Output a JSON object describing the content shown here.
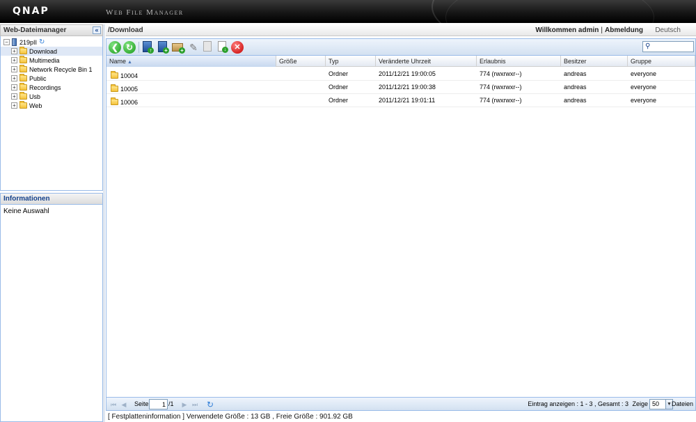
{
  "header": {
    "logo": "QNAP",
    "app_title": "Web File Manager"
  },
  "left_panel": {
    "title": "Web-Dateimanager",
    "collapse_glyph": "«",
    "tree": {
      "root": "219pII",
      "items": [
        {
          "label": "Download",
          "selected": true
        },
        {
          "label": "Multimedia"
        },
        {
          "label": "Network Recycle Bin 1"
        },
        {
          "label": "Public"
        },
        {
          "label": "Recordings"
        },
        {
          "label": "Usb"
        },
        {
          "label": "Web"
        }
      ]
    }
  },
  "info_panel": {
    "title": "Informationen",
    "body": "Keine Auswahl"
  },
  "path_bar": {
    "path": "/Download",
    "welcome": "Willkommen admin",
    "separator": "|",
    "logout": "Abmeldung",
    "language": "Deutsch"
  },
  "toolbar": {
    "icons": [
      "back-icon",
      "refresh-icon",
      "upload-icon",
      "new-file-icon",
      "new-folder-icon",
      "rename-icon",
      "copy-icon",
      "download-icon",
      "delete-icon"
    ],
    "search_placeholder": ""
  },
  "grid": {
    "columns": [
      "Name",
      "Größe",
      "Typ",
      "Veränderte Uhrzeit",
      "Erlaubnis",
      "Besitzer",
      "Gruppe"
    ],
    "sort_column": "Name",
    "sort_dir": "asc",
    "rows": [
      {
        "name": "10004",
        "size": "",
        "type": "Ordner",
        "modified": "2011/12/21 19:00:05",
        "permission": "774 (rwxrwxr--)",
        "owner": "andreas",
        "group": "everyone"
      },
      {
        "name": "10005",
        "size": "",
        "type": "Ordner",
        "modified": "2011/12/21 19:00:38",
        "permission": "774 (rwxrwxr--)",
        "owner": "andreas",
        "group": "everyone"
      },
      {
        "name": "10006",
        "size": "",
        "type": "Ordner",
        "modified": "2011/12/21 19:01:11",
        "permission": "774 (rwxrwxr--)",
        "owner": "andreas",
        "group": "everyone"
      }
    ]
  },
  "pager": {
    "page_label": "Seite",
    "page_value": "1",
    "page_total": "/1",
    "entries_info": "Eintrag anzeigen : 1 - 3 , Gesamt : 3",
    "show_label": "Zeige",
    "page_size": "50",
    "files_label": "Dateien"
  },
  "status": {
    "text": "[ Festplatteninformation ] Verwendete Größe : 13 GB , Freie Größe : 901.92 GB"
  }
}
